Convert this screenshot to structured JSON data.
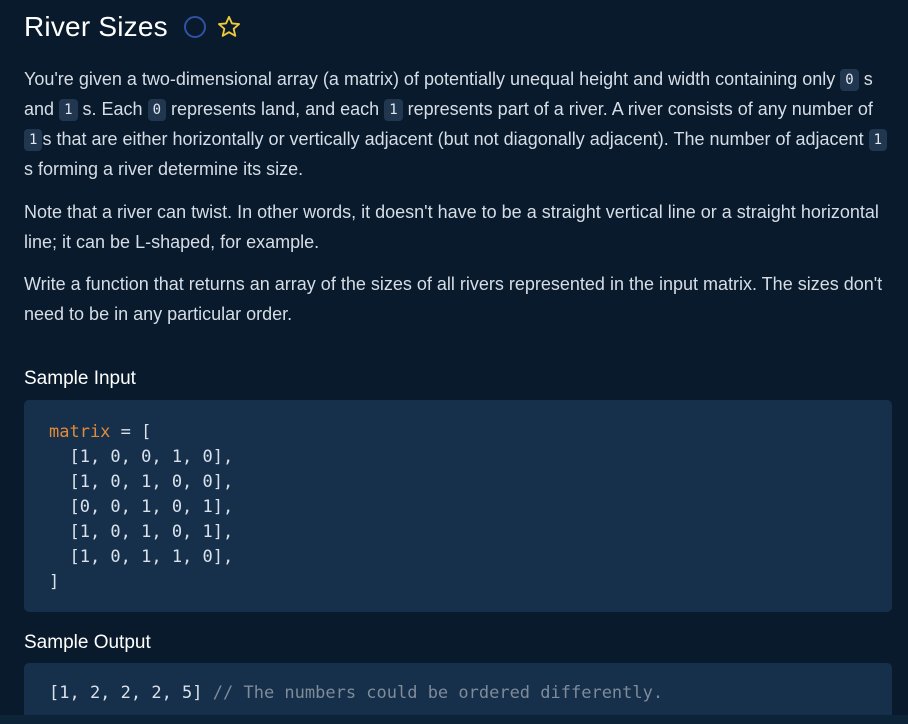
{
  "title": "River Sizes",
  "paragraph1": {
    "p1": "You're given a two-dimensional array (a matrix) of potentially unequal height and width containing only",
    "chip1": "0",
    "p2": "s and",
    "chip2": "1",
    "p3": "s. Each",
    "chip3": "0",
    "p4": "represents land, and each",
    "chip4": "1",
    "p5": "represents part of a river. A river consists of any number of",
    "chip5": "1",
    "p6": "s that are either horizontally or vertically adjacent (but not diagonally adjacent). The number of adjacent",
    "chip6": "1",
    "p7": "s forming a river determine its size."
  },
  "paragraph2": "Note that a river can twist. In other words, it doesn't have to be a straight vertical line or a straight horizontal line; it can be L-shaped, for example.",
  "paragraph3": "Write a function that returns an array of the sizes of all rivers represented in the input matrix. The sizes don't need to be in any particular order.",
  "sample_input": {
    "heading": "Sample Input",
    "var_name": "matrix",
    "assign": " = [",
    "rows": [
      "  [1, 0, 0, 1, 0],",
      "  [1, 0, 1, 0, 0],",
      "  [0, 0, 1, 0, 1],",
      "  [1, 0, 1, 0, 1],",
      "  [1, 0, 1, 1, 0],"
    ],
    "close": "]"
  },
  "sample_output": {
    "heading": "Sample Output",
    "value": "[1, 2, 2, 2, 5]",
    "comment": " // The numbers could be ordered differently."
  },
  "colors": {
    "background": "#081a2b",
    "code_block": "#16304b",
    "keyword": "#e08a3c",
    "comment": "#7e8b99",
    "star": "#f0c93a"
  },
  "icons": [
    "completion-circle-icon",
    "star-icon"
  ]
}
